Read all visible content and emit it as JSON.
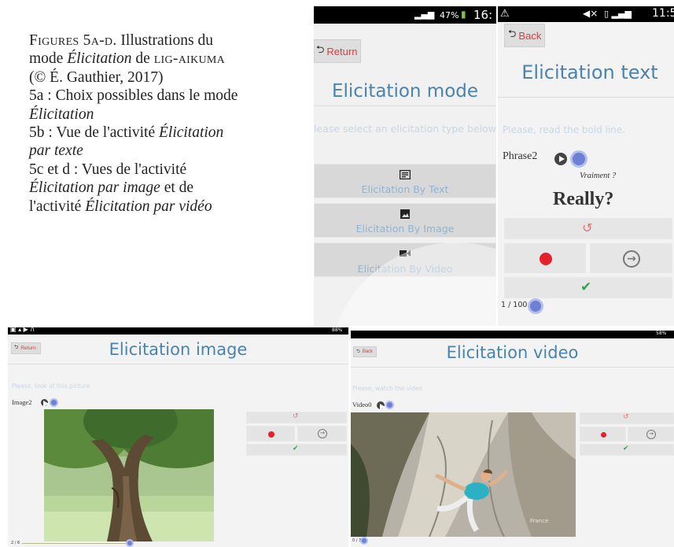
{
  "caption": {
    "line1_sc": "Figures 5a-d.",
    "line1_rest": " Illustrations du",
    "line2_pre": "mode ",
    "line2_em": "Élicitation",
    "line2_mid": " de ",
    "line2_sc": "lig-aikuma",
    "line3": "(© É. Gauthier, 2017)",
    "line4": "5a : Choix possibles dans le mode",
    "line5_em": "Élicitation",
    "line6_pre": "5b : Vue de l'activité ",
    "line6_em": "Élicitation",
    "line7_em": "par texte",
    "line8": "5c et d : Vues de l'activité",
    "line9_em": "Élicitation par image",
    "line9_rest": " et de",
    "line10_pre": "l'activité ",
    "line10_em": "Élicitation par vidéo"
  },
  "screen_a": {
    "status_text": "47%",
    "status_time": "16:",
    "back_label": "Return",
    "title": "Elicitation mode",
    "hint": "lease select an elicitation type below",
    "buttons": [
      {
        "label": "Elicitation By Text",
        "icon": "text-icon"
      },
      {
        "label": "Elicitation By Image",
        "icon": "image-icon"
      },
      {
        "label": "Elicitation By Video",
        "icon": "video-icon"
      }
    ]
  },
  "screen_b": {
    "status_time": "11:5",
    "back_label": "Back",
    "title": "Elicitation text",
    "hint": "Please, read the bold line.",
    "phrase_label": "Phrase2",
    "translation": "Vraiment ?",
    "bold_line": "Really?",
    "counter": "1 / 100"
  },
  "screen_c": {
    "status_text": "88%",
    "back_label": "Return",
    "title": "Elicitation image",
    "hint": "Please, look at this picture",
    "item_label": "Image2",
    "counter": "2 / 6"
  },
  "screen_d": {
    "status_text": "58%",
    "back_label": "Back",
    "title": "Elicitation video",
    "hint": "Please, watch the video",
    "item_label": "Video0",
    "counter": "0 / 3",
    "watermark": "France"
  },
  "colors": {
    "title_blue": "#4a83ad",
    "record_red": "#e5212b",
    "check_green": "#2ea84a",
    "back_red": "#e53935"
  }
}
